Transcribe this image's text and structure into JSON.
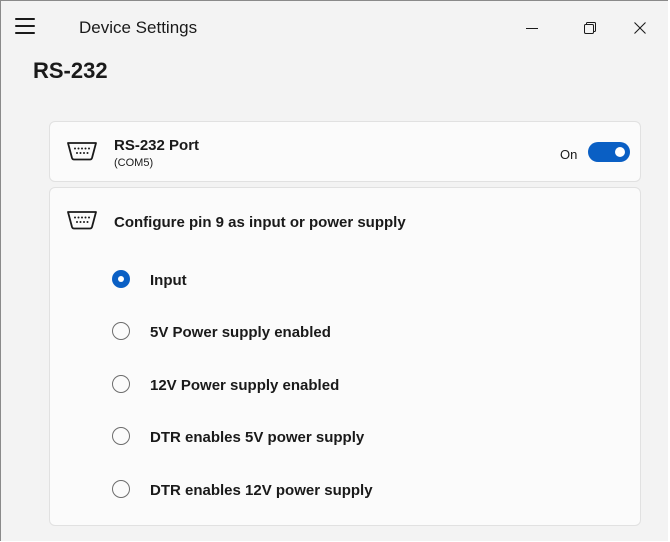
{
  "window": {
    "title": "Device Settings",
    "controls": {
      "minimize": "minimize",
      "maximize": "maximize",
      "close": "close"
    }
  },
  "page": {
    "title": "RS-232"
  },
  "port_card": {
    "title": "RS-232 Port",
    "subtitle": "(COM5)",
    "icon": "serial-port-icon",
    "toggle": {
      "label": "On",
      "state": true
    }
  },
  "config_card": {
    "title": "Configure pin 9 as input or power supply",
    "icon": "serial-port-icon",
    "options": [
      {
        "label": "Input",
        "checked": true
      },
      {
        "label": "5V Power supply enabled",
        "checked": false
      },
      {
        "label": "12V Power supply enabled",
        "checked": false
      },
      {
        "label": "DTR enables 5V power supply",
        "checked": false
      },
      {
        "label": "DTR enables 12V power supply",
        "checked": false
      }
    ]
  },
  "colors": {
    "accent": "#0a5fc4",
    "background": "#f3f3f3",
    "card": "#fbfbfb"
  }
}
